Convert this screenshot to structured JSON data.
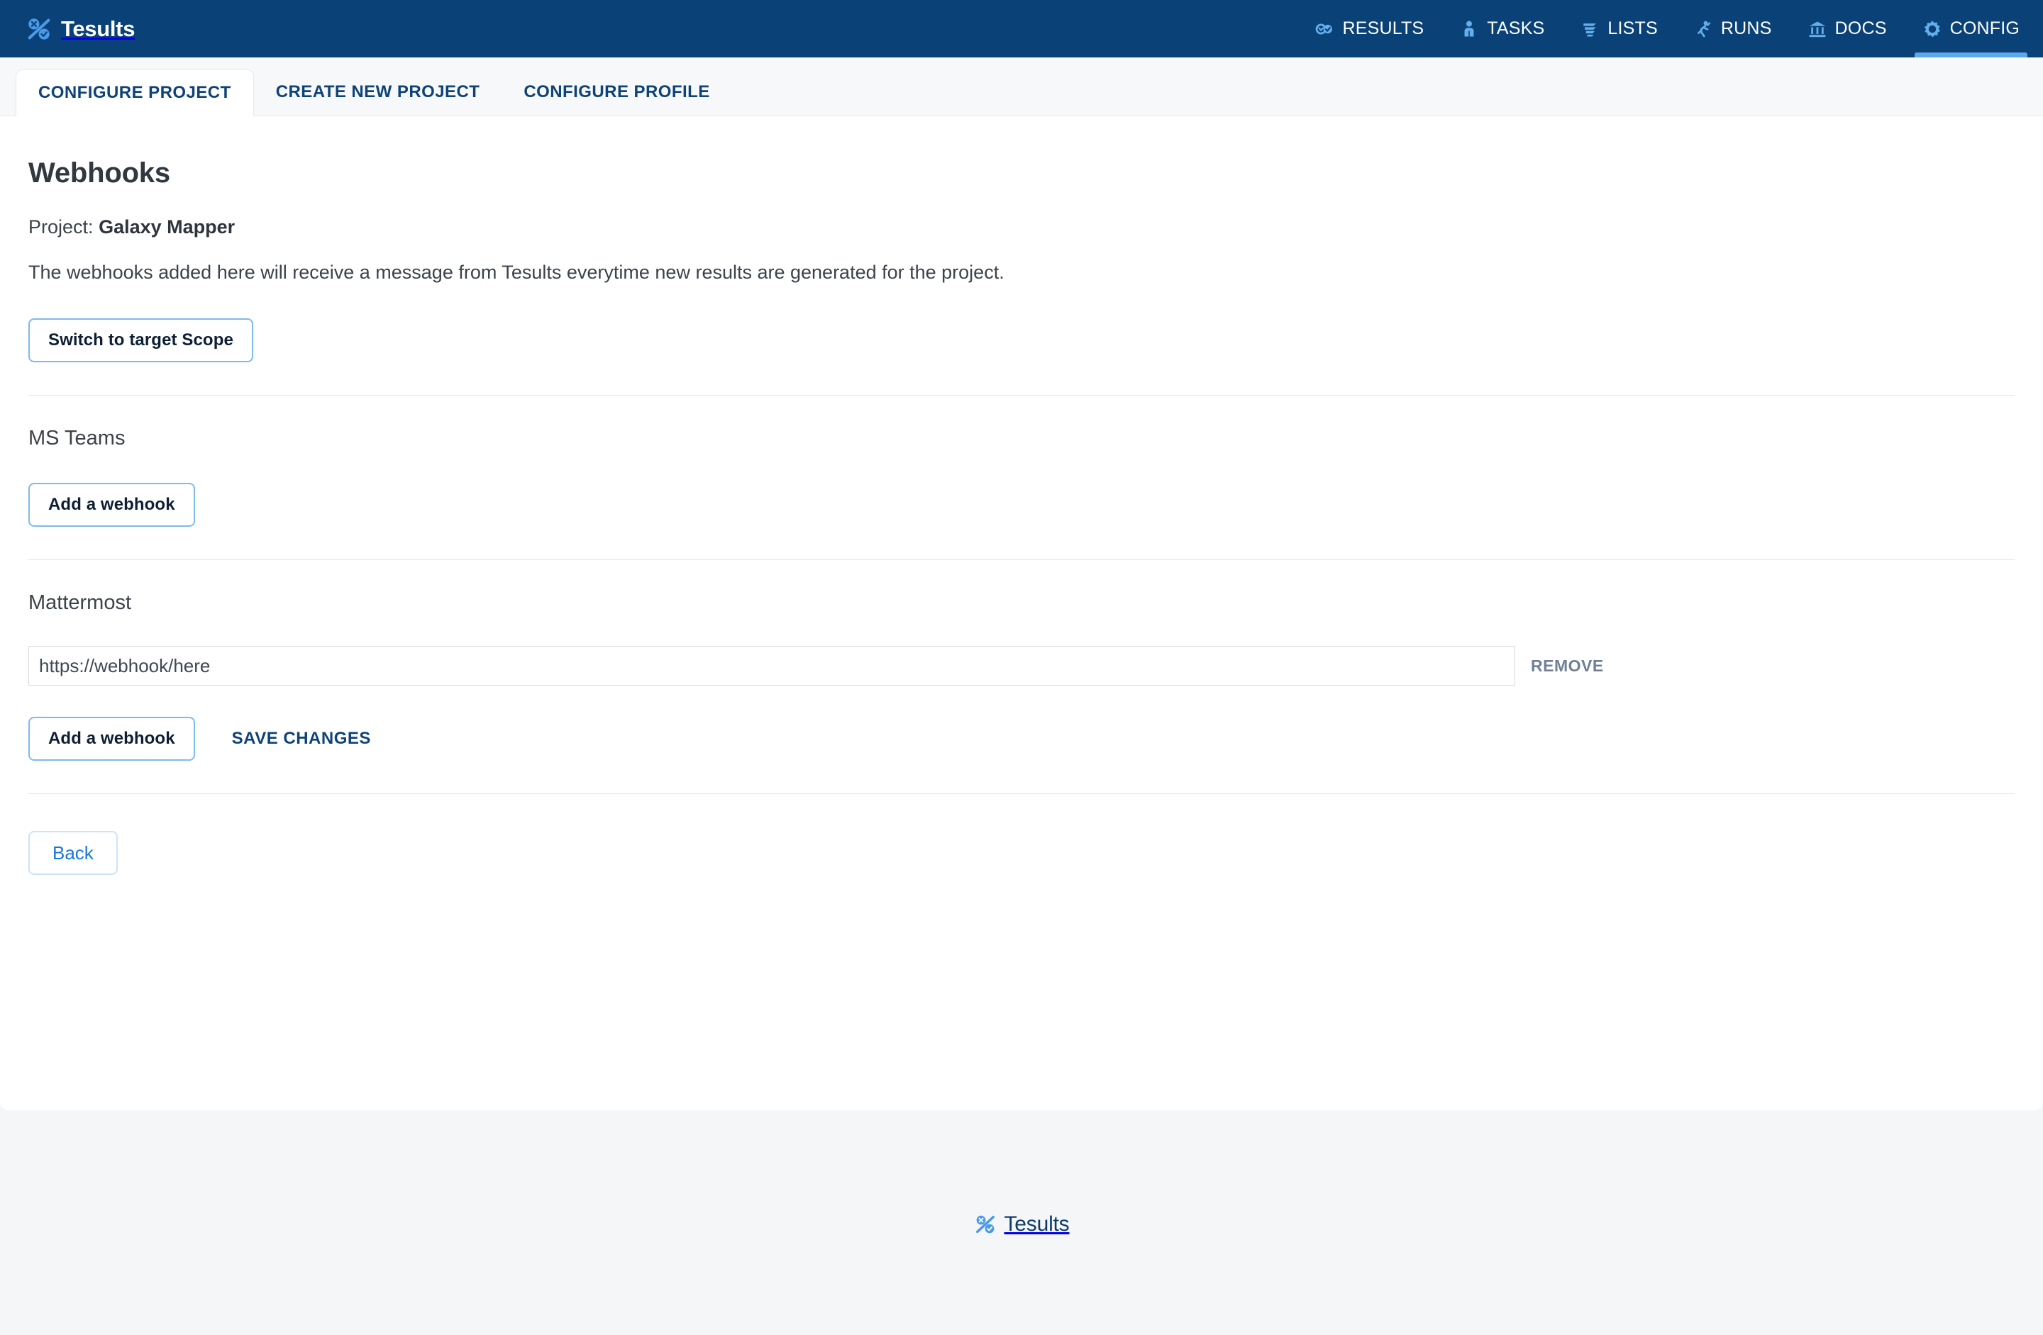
{
  "brand": {
    "name": "Tesults",
    "logo_icon": "percent-x-check-icon",
    "logo_color": "#4a9ae8"
  },
  "navbar": {
    "background": "#0a4176",
    "active_indicator_color": "#5ba7e8",
    "items": [
      {
        "label": "RESULTS",
        "icon": "results-infinity-check-icon",
        "active": false
      },
      {
        "label": "TASKS",
        "icon": "person-tasks-icon",
        "active": false
      },
      {
        "label": "LISTS",
        "icon": "lists-lines-icon",
        "active": false
      },
      {
        "label": "RUNS",
        "icon": "running-person-icon",
        "active": false
      },
      {
        "label": "DOCS",
        "icon": "bank-building-icon",
        "active": false
      },
      {
        "label": "CONFIG",
        "icon": "gear-icon",
        "active": true
      }
    ]
  },
  "tabs": [
    {
      "label": "CONFIGURE PROJECT",
      "active": true
    },
    {
      "label": "CREATE NEW PROJECT",
      "active": false
    },
    {
      "label": "CONFIGURE PROFILE",
      "active": false
    }
  ],
  "main": {
    "title": "Webhooks",
    "project_label": "Project:",
    "project_name": "Galaxy Mapper",
    "description": "The webhooks added here will receive a message from Tesults everytime new results are generated for the project.",
    "switch_scope_label": "Switch to target Scope",
    "sections": [
      {
        "title": "MS Teams",
        "add_label": "Add a webhook",
        "webhooks": []
      },
      {
        "title": "Mattermost",
        "add_label": "Add a webhook",
        "save_label": "SAVE CHANGES",
        "webhooks": [
          {
            "value": "https://webhook/here",
            "placeholder": "https://webhook/here",
            "remove_label": "REMOVE"
          }
        ]
      }
    ],
    "back_label": "Back"
  },
  "footer": {
    "name": "Tesults",
    "logo_icon": "percent-x-check-icon"
  }
}
